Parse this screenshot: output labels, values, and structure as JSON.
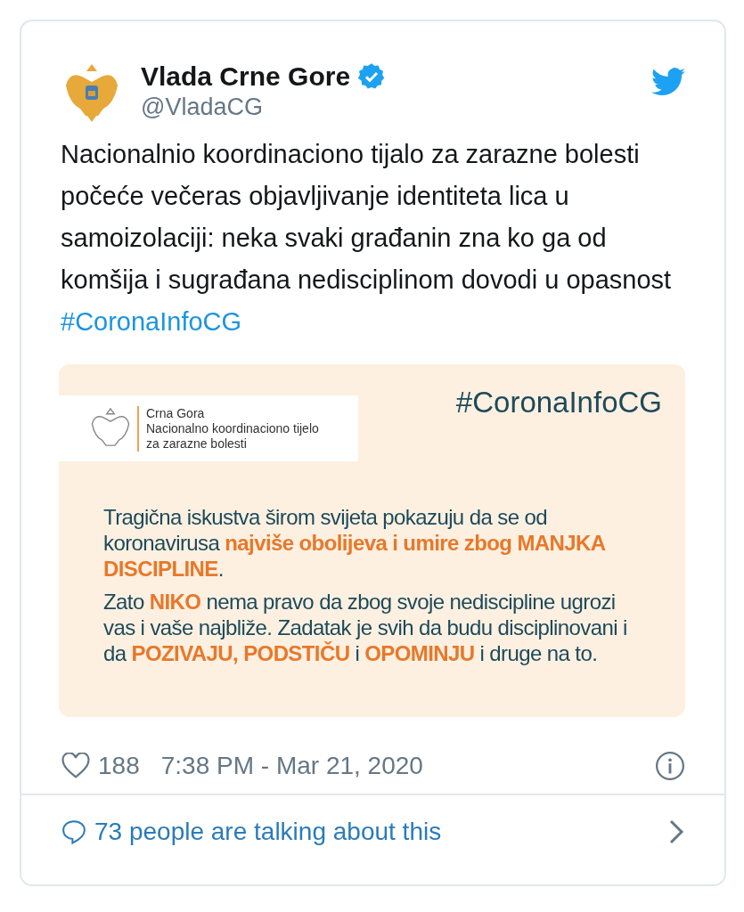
{
  "author": {
    "name": "Vlada Crne Gore",
    "verified": true,
    "handle": "@VladaCG"
  },
  "tweet": {
    "text": "Nacionalnio koordinaciono tijalo za zarazne bolesti počeće večeras objavljivanje identiteta lica u samoizolaciji: neka svaki građanin zna ko ga od komšija i sugrađana nedisciplinom dovodi u opasnost",
    "hashtag": "#CoronaInfoCG"
  },
  "media": {
    "org_lines": [
      "Crna Gora",
      "Nacionalno koordinaciono tijelo",
      "za zarazne bolesti"
    ],
    "hashtag": "#CoronaInfoCG",
    "paragraphs": [
      "Tragična iskustva širom svijeta pokazuju da se od koronavirusa **najviše obolijeva i umire zbog MANJKA DISCIPLINE**.",
      "Zato **NIKO** nema pravo da zbog svoje nediscipline ugrozi vas i vaše najbliže. Zadatak je svih da budu disciplinovani i da **POZIVAJU, PODSTIČU** i **OPOMINJU** i druge na to."
    ]
  },
  "stats": {
    "likes": "188",
    "timestamp": "7:38 PM - Mar 21, 2020"
  },
  "conversation": {
    "label": "73 people are talking about this"
  }
}
